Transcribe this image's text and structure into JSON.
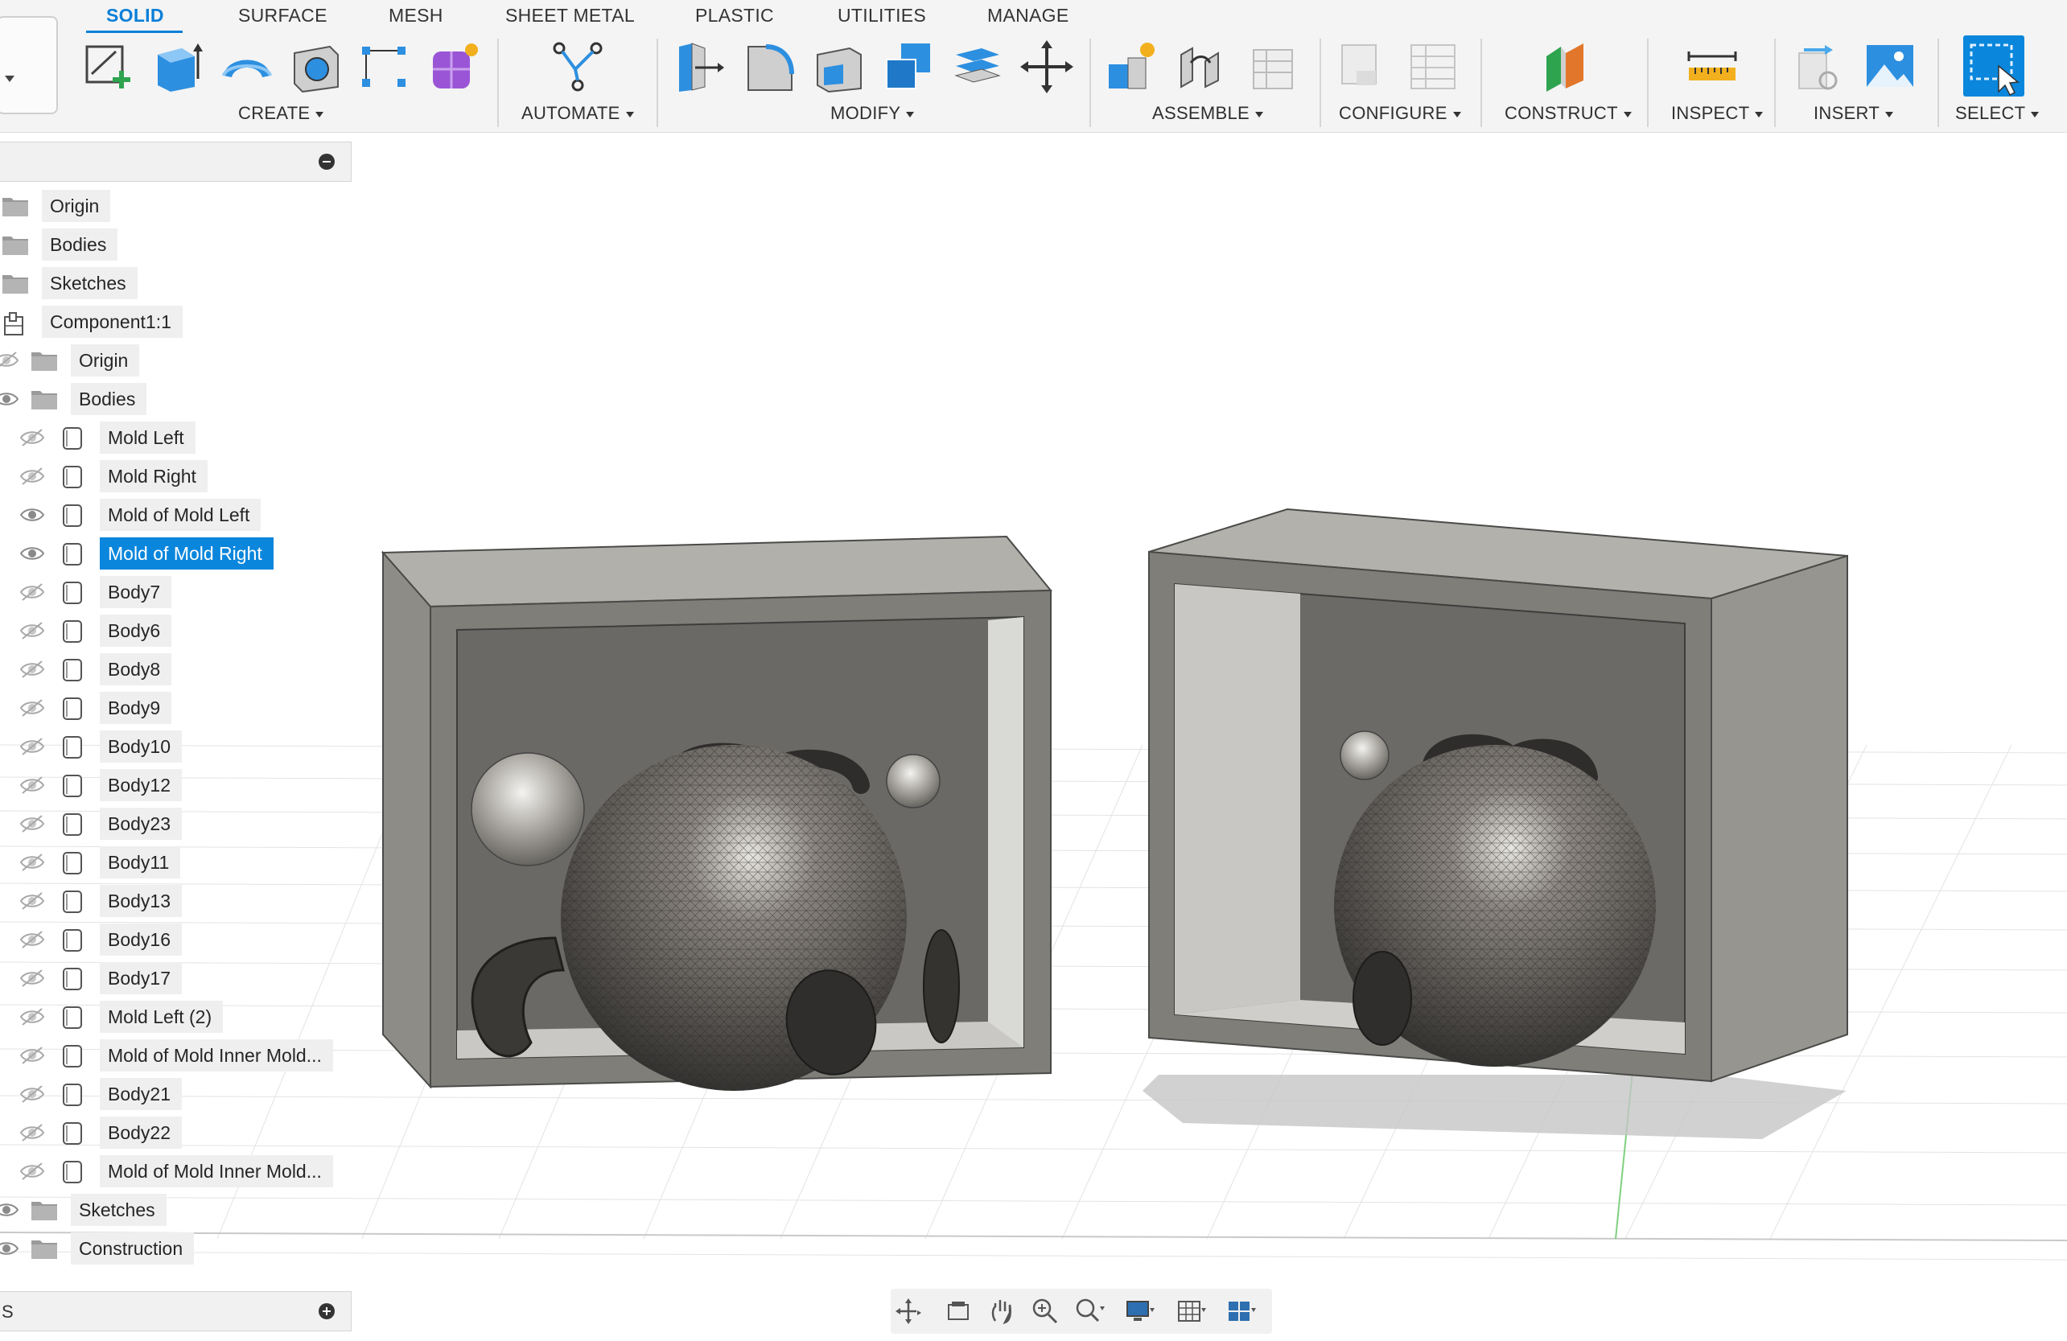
{
  "toolbar": {
    "tabs": [
      {
        "label": "SOLID",
        "active": true
      },
      {
        "label": "SURFACE"
      },
      {
        "label": "MESH"
      },
      {
        "label": "SHEET METAL"
      },
      {
        "label": "PLASTIC"
      },
      {
        "label": "UTILITIES"
      },
      {
        "label": "MANAGE"
      }
    ],
    "groups": [
      {
        "label": "CREATE",
        "tools": [
          "create-sketch-icon",
          "extrude-icon",
          "revolve-icon",
          "hole-icon",
          "pattern-icon",
          "create-form-icon"
        ]
      },
      {
        "label": "AUTOMATE",
        "tools": [
          "automated-modeling-icon"
        ]
      },
      {
        "label": "MODIFY",
        "tools": [
          "press-pull-icon",
          "fillet-icon",
          "shell-icon",
          "combine-icon",
          "offset-face-icon",
          "move-copy-icon"
        ]
      },
      {
        "label": "ASSEMBLE",
        "tools": [
          "new-component-icon",
          "joint-icon",
          "bill-of-materials-icon"
        ]
      },
      {
        "label": "CONFIGURE",
        "tools": [
          "configure-icon",
          "configuration-table-icon"
        ]
      },
      {
        "label": "CONSTRUCT",
        "tools": [
          "offset-plane-icon"
        ]
      },
      {
        "label": "INSPECT",
        "tools": [
          "measure-icon"
        ]
      },
      {
        "label": "INSERT",
        "tools": [
          "insert-derive-icon",
          "insert-canvas-icon"
        ]
      },
      {
        "label": "SELECT",
        "tools": [
          "select-icon"
        ]
      }
    ],
    "accent_color": "#0a7fd8"
  },
  "browser": {
    "items": [
      {
        "label": "Origin",
        "type": "folder"
      },
      {
        "label": "Bodies",
        "type": "folder"
      },
      {
        "label": "Sketches",
        "type": "folder"
      },
      {
        "label": "Component1:1",
        "type": "component"
      },
      {
        "label": "Origin",
        "type": "folder",
        "visibility": "hidden"
      },
      {
        "label": "Bodies",
        "type": "folder",
        "visibility": "visible"
      },
      {
        "label": "Mold Left",
        "type": "body",
        "visibility": "hidden"
      },
      {
        "label": "Mold Right",
        "type": "body",
        "visibility": "hidden"
      },
      {
        "label": "Mold of Mold Left",
        "type": "body",
        "visibility": "visible"
      },
      {
        "label": "Mold of Mold Right",
        "type": "body",
        "visibility": "visible",
        "selected": true
      },
      {
        "label": "Body7",
        "type": "body",
        "visibility": "hidden"
      },
      {
        "label": "Body6",
        "type": "body",
        "visibility": "hidden"
      },
      {
        "label": "Body8",
        "type": "body",
        "visibility": "hidden"
      },
      {
        "label": "Body9",
        "type": "body",
        "visibility": "hidden"
      },
      {
        "label": "Body10",
        "type": "body",
        "visibility": "hidden"
      },
      {
        "label": "Body12",
        "type": "body",
        "visibility": "hidden"
      },
      {
        "label": "Body23",
        "type": "body",
        "visibility": "hidden"
      },
      {
        "label": "Body11",
        "type": "body",
        "visibility": "hidden"
      },
      {
        "label": "Body13",
        "type": "body",
        "visibility": "hidden"
      },
      {
        "label": "Body16",
        "type": "body",
        "visibility": "hidden"
      },
      {
        "label": "Body17",
        "type": "body",
        "visibility": "hidden"
      },
      {
        "label": "Mold Left (2)",
        "type": "body",
        "visibility": "hidden"
      },
      {
        "label": "Mold of Mold Inner Mold...",
        "type": "body",
        "visibility": "hidden"
      },
      {
        "label": "Body21",
        "type": "body",
        "visibility": "hidden"
      },
      {
        "label": "Body22",
        "type": "body",
        "visibility": "hidden"
      },
      {
        "label": "Mold of Mold Inner Mold...",
        "type": "body",
        "visibility": "hidden"
      },
      {
        "label": "Sketches",
        "type": "folder",
        "visibility": "visible"
      },
      {
        "label": "Construction",
        "type": "folder",
        "visibility": "visible"
      }
    ],
    "selection_color": "#0a86dc"
  },
  "footer": {
    "label": "S"
  },
  "navbar": {
    "tools": [
      "orbit-icon",
      "look-at-icon",
      "pan-icon",
      "zoom-icon",
      "fit-icon",
      "display-settings-icon",
      "grid-settings-icon",
      "viewports-icon"
    ]
  }
}
